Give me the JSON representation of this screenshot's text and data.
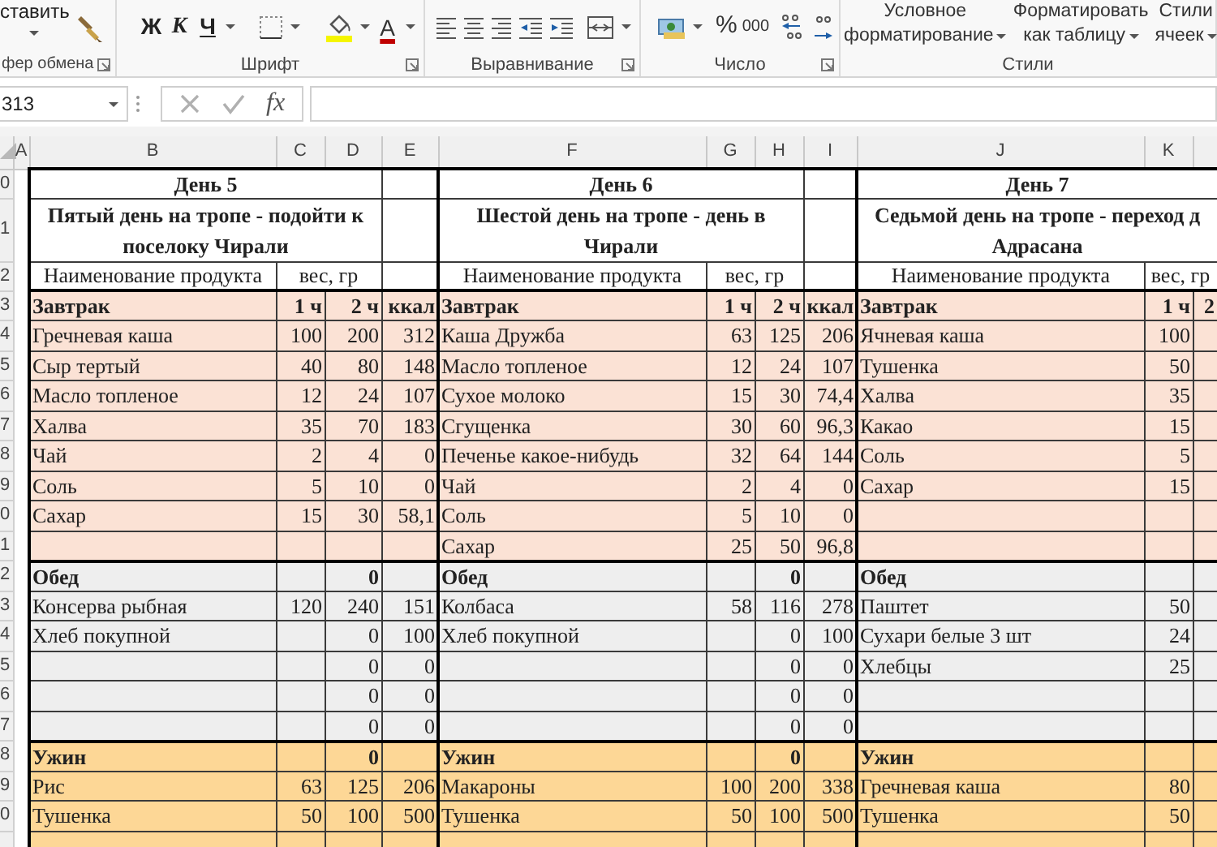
{
  "ribbon": {
    "clipboard": {
      "paste_label": "ставить",
      "group_label": "фер обмена"
    },
    "font": {
      "bold": "Ж",
      "italic": "К",
      "underline": "Ч",
      "font_color": "A",
      "group_label": "Шрифт"
    },
    "alignment": {
      "group_label": "Выравнивание"
    },
    "number": {
      "percent": "%",
      "thousands": "000",
      "group_label": "Число"
    },
    "styles": {
      "conditional": "Условное форматирование",
      "format_table": "Форматировать как таблицу",
      "cell_styles": "Стили ячеек",
      "group_label": "Стили"
    }
  },
  "formula_bar": {
    "name_box": "313",
    "fx": "fx"
  },
  "column_headers": [
    "A",
    "B",
    "C",
    "D",
    "E",
    "F",
    "G",
    "H",
    "I",
    "J",
    "K"
  ],
  "row_numbers": [
    "0",
    "1",
    "2",
    "3",
    "4",
    "5",
    "6",
    "7",
    "8",
    "9",
    "0",
    "1",
    "2",
    "3",
    "4",
    "5",
    "6",
    "7",
    "8",
    "9",
    "0"
  ],
  "blocks": [
    {
      "title": "День 5",
      "subtitle": "Пятый день на тропе - подойти к поселоку Чирали",
      "header": {
        "name": "Наименование продукта",
        "weight": "вес, гр"
      },
      "meals": [
        {
          "color": "#fbe2d5",
          "rows": [
            {
              "kind": "meal",
              "name": "Завтрак",
              "c1": "1 ч",
              "c2": "2 ч",
              "kcal": "ккал"
            },
            {
              "kind": "item",
              "name": "Гречневая каша",
              "c1": "100",
              "c2": "200",
              "kcal": "312"
            },
            {
              "kind": "item",
              "name": "Сыр тертый",
              "c1": "40",
              "c2": "80",
              "kcal": "148"
            },
            {
              "kind": "item",
              "name": "Масло топленое",
              "c1": "12",
              "c2": "24",
              "kcal": "107"
            },
            {
              "kind": "item",
              "name": "Халва",
              "c1": "35",
              "c2": "70",
              "kcal": "183"
            },
            {
              "kind": "item",
              "name": "Чай",
              "c1": "2",
              "c2": "4",
              "kcal": "0"
            },
            {
              "kind": "item",
              "name": "Соль",
              "c1": "5",
              "c2": "10",
              "kcal": "0"
            },
            {
              "kind": "item",
              "name": "Сахар",
              "c1": "15",
              "c2": "30",
              "kcal": "58,1"
            },
            {
              "kind": "item"
            }
          ]
        },
        {
          "color": "#eeeeee",
          "rows": [
            {
              "kind": "meal",
              "name": "Обед",
              "c2": "0"
            },
            {
              "kind": "item",
              "name": "Консерва рыбная",
              "c1": "120",
              "c2": "240",
              "kcal": "151"
            },
            {
              "kind": "item",
              "name": "Хлеб покупной",
              "c2": "0",
              "kcal": "100"
            },
            {
              "kind": "item",
              "c2": "0",
              "kcal": "0"
            },
            {
              "kind": "item",
              "c2": "0",
              "kcal": "0"
            },
            {
              "kind": "item",
              "c2": "0",
              "kcal": "0"
            }
          ]
        },
        {
          "color": "#fdd796",
          "rows": [
            {
              "kind": "meal",
              "name": "Ужин",
              "c2": "0"
            },
            {
              "kind": "item",
              "name": "Рис",
              "c1": "63",
              "c2": "125",
              "kcal": "206"
            },
            {
              "kind": "item",
              "name": "Тушенка",
              "c1": "50",
              "c2": "100",
              "kcal": "500"
            },
            {
              "kind": "item"
            }
          ]
        }
      ]
    },
    {
      "title": "День 6",
      "subtitle": "Шестой день на тропе - день в Чирали",
      "header": {
        "name": "Наименование продукта",
        "weight": "вес, гр"
      },
      "meals": [
        {
          "color": "#fbe2d5",
          "rows": [
            {
              "kind": "meal",
              "name": "Завтрак",
              "c1": "1 ч",
              "c2": "2 ч",
              "kcal": "ккал"
            },
            {
              "kind": "item",
              "name": "Каша Дружба",
              "c1": "63",
              "c2": "125",
              "kcal": "206"
            },
            {
              "kind": "item",
              "name": "Масло топленое",
              "c1": "12",
              "c2": "24",
              "kcal": "107"
            },
            {
              "kind": "item",
              "name": "Сухое молоко",
              "c1": "15",
              "c2": "30",
              "kcal": "74,4"
            },
            {
              "kind": "item",
              "name": "Сгущенка",
              "c1": "30",
              "c2": "60",
              "kcal": "96,3"
            },
            {
              "kind": "item",
              "name": "Печенье какое-нибудь",
              "c1": "32",
              "c2": "64",
              "kcal": "144"
            },
            {
              "kind": "item",
              "name": "Чай",
              "c1": "2",
              "c2": "4",
              "kcal": "0"
            },
            {
              "kind": "item",
              "name": "Соль",
              "c1": "5",
              "c2": "10",
              "kcal": "0"
            },
            {
              "kind": "item",
              "name": "Сахар",
              "c1": "25",
              "c2": "50",
              "kcal": "96,8"
            }
          ]
        },
        {
          "color": "#eeeeee",
          "rows": [
            {
              "kind": "meal",
              "name": "Обед",
              "c2": "0"
            },
            {
              "kind": "item",
              "name": "Колбаса",
              "c1": "58",
              "c2": "116",
              "kcal": "278"
            },
            {
              "kind": "item",
              "name": "Хлеб покупной",
              "c2": "0",
              "kcal": "100"
            },
            {
              "kind": "item",
              "c2": "0",
              "kcal": "0"
            },
            {
              "kind": "item",
              "c2": "0",
              "kcal": "0"
            },
            {
              "kind": "item",
              "c2": "0",
              "kcal": "0"
            }
          ]
        },
        {
          "color": "#fdd796",
          "rows": [
            {
              "kind": "meal",
              "name": "Ужин",
              "c2": "0"
            },
            {
              "kind": "item",
              "name": "Макароны",
              "c1": "100",
              "c2": "200",
              "kcal": "338"
            },
            {
              "kind": "item",
              "name": "Тушенка",
              "c1": "50",
              "c2": "100",
              "kcal": "500"
            },
            {
              "kind": "item"
            }
          ]
        }
      ]
    },
    {
      "title": "День 7",
      "subtitle": "Седьмой день на тропе - переход д Адрасана",
      "header": {
        "name": "Наименование продукта",
        "weight": "вес, гр"
      },
      "meals": [
        {
          "color": "#fbe2d5",
          "rows": [
            {
              "kind": "meal",
              "name": "Завтрак",
              "c1": "1 ч",
              "c2": "2"
            },
            {
              "kind": "item",
              "name": "Ячневая каша",
              "c1": "100"
            },
            {
              "kind": "item",
              "name": "Тушенка",
              "c1": "50"
            },
            {
              "kind": "item",
              "name": "Халва",
              "c1": "35"
            },
            {
              "kind": "item",
              "name": "Какао",
              "c1": "15"
            },
            {
              "kind": "item",
              "name": "Соль",
              "c1": "5"
            },
            {
              "kind": "item",
              "name": "Сахар",
              "c1": "15"
            },
            {
              "kind": "item"
            },
            {
              "kind": "item"
            }
          ]
        },
        {
          "color": "#eeeeee",
          "rows": [
            {
              "kind": "meal",
              "name": "Обед"
            },
            {
              "kind": "item",
              "name": "Паштет",
              "c1": "50"
            },
            {
              "kind": "item",
              "name": "Сухари белые 3 шт",
              "c1": "24"
            },
            {
              "kind": "item",
              "name": "Хлебцы",
              "c1": "25"
            },
            {
              "kind": "item"
            },
            {
              "kind": "item"
            }
          ]
        },
        {
          "color": "#fdd796",
          "rows": [
            {
              "kind": "meal",
              "name": "Ужин"
            },
            {
              "kind": "item",
              "name": "Гречневая каша",
              "c1": "80"
            },
            {
              "kind": "item",
              "name": "Тушенка",
              "c1": "50"
            },
            {
              "kind": "item"
            }
          ]
        }
      ]
    }
  ]
}
